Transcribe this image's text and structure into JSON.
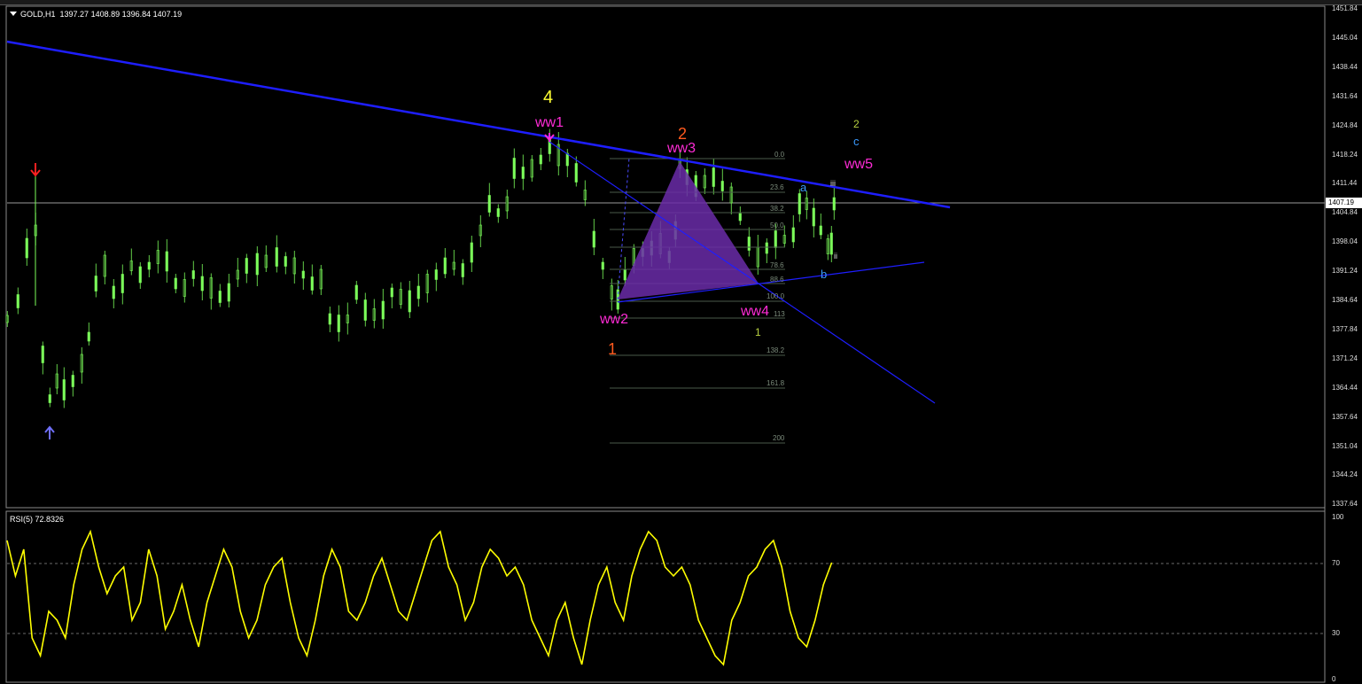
{
  "chart_header": {
    "symbol": "GOLD,H1",
    "ohlc": "1397.27 1408.89 1396.84 1407.19"
  },
  "price_axis": {
    "ticks": [
      "1451.84",
      "1445.04",
      "1438.44",
      "1431.64",
      "1424.84",
      "1418.24",
      "1411.44",
      "1404.84",
      "1398.04",
      "1391.24",
      "1384.64",
      "1377.84",
      "1371.24",
      "1364.44",
      "1357.64",
      "1351.04",
      "1344.24",
      "1337.64"
    ],
    "current_price": "1407.19"
  },
  "rsi_panel": {
    "title": "RSI(5) 72.8326",
    "levels": [
      "100",
      "70",
      "30",
      "0"
    ]
  },
  "wave_labels": {
    "major_4": "4",
    "major_2": "2",
    "major_1": "1",
    "ww1": "ww1",
    "ww2": "ww2",
    "ww3": "ww3",
    "ww4": "ww4",
    "ww5": "ww5",
    "minor_2": "2",
    "minor_c": "c",
    "minor_a": "a",
    "minor_b": "b",
    "minor_1": "1",
    "sub_iii": "iii",
    "sub_ii": "ii"
  },
  "fibonacci_levels": [
    "0.0",
    "23.6",
    "38.2",
    "50.0",
    "61.8",
    "78.6",
    "88.6",
    "100.0",
    "113",
    "138.2",
    "161.8",
    "200"
  ],
  "colors": {
    "background": "#000000",
    "candles": "#7cff5a",
    "rsi_line": "#ffff00",
    "trendline": "#1e1eff",
    "pattern_fill": "#6a2ca8",
    "wave_magenta": "#ff2bd6",
    "wave_orange": "#ff5a1e",
    "wave_yellow": "#ffff33",
    "wave_blue": "#3a9aff",
    "wave_olive": "#b8d040"
  }
}
